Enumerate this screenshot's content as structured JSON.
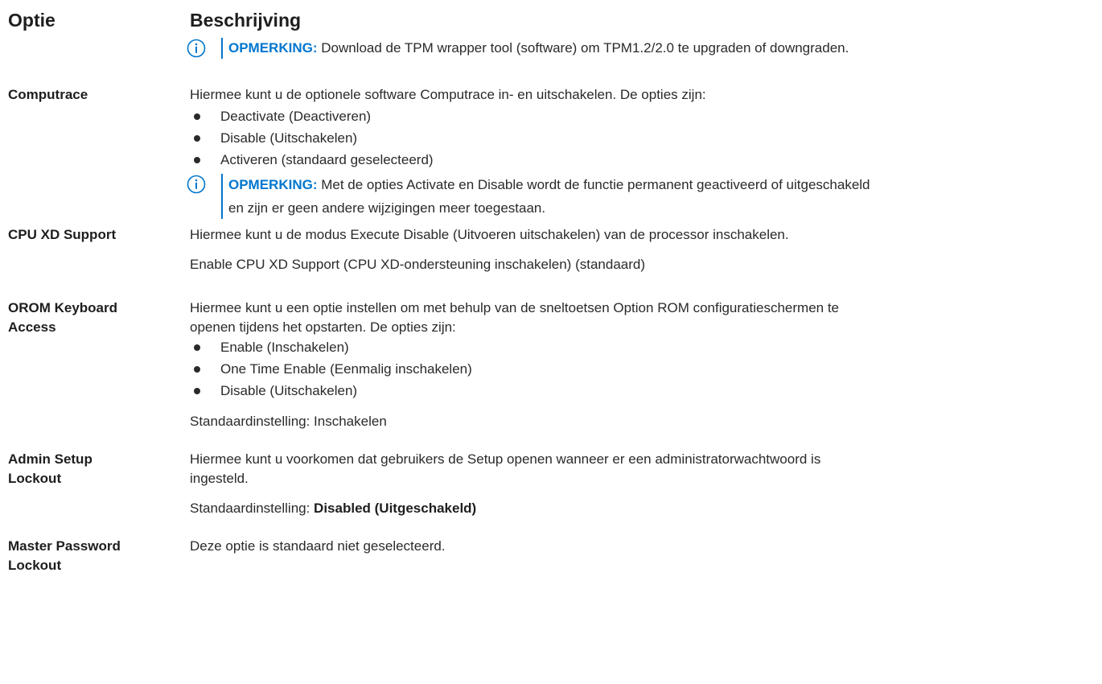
{
  "header": {
    "option": "Optie",
    "description": "Beschrijving"
  },
  "tpm_note": {
    "label": "OPMERKING:",
    "text": " Download de TPM wrapper tool (software) om TPM1.2/2.0 te upgraden of downgraden."
  },
  "computrace": {
    "label": "Computrace",
    "intro": "Hiermee kunt u de optionele software Computrace in- en uitschakelen. De opties zijn:",
    "items": [
      "Deactivate (Deactiveren)",
      "Disable (Uitschakelen)",
      "Activeren (standaard geselecteerd)"
    ],
    "note_label": "OPMERKING:",
    "note_line1": " Met de opties Activate en Disable wordt de functie permanent geactiveerd of uitgeschakeld",
    "note_line2": "en zijn er geen andere wijzigingen meer toegestaan."
  },
  "cpu_xd": {
    "label": "CPU XD Support",
    "line1": "Hiermee kunt u de modus Execute Disable (Uitvoeren uitschakelen) van de processor inschakelen.",
    "line2": "Enable CPU XD Support (CPU XD-ondersteuning inschakelen) (standaard)"
  },
  "orom": {
    "label_line1": "OROM Keyboard",
    "label_line2": "Access",
    "intro_line1": "Hiermee kunt u een optie instellen om met behulp van de sneltoetsen Option ROM configuratieschermen te",
    "intro_line2": "openen tijdens het opstarten. De opties zijn:",
    "items": [
      "Enable (Inschakelen)",
      "One Time Enable (Eenmalig inschakelen)",
      "Disable (Uitschakelen)"
    ],
    "default": "Standaardinstelling: Inschakelen"
  },
  "admin_lockout": {
    "label_line1": "Admin Setup",
    "label_line2": "Lockout",
    "line1": "Hiermee kunt u voorkomen dat gebruikers de Setup openen wanneer er een administratorwachtwoord is",
    "line2": "ingesteld.",
    "default_prefix": "Standaardinstelling: ",
    "default_value": "Disabled (Uitgeschakeld)"
  },
  "master_lockout": {
    "label_line1": "Master Password",
    "label_line2": "Lockout",
    "text": "Deze optie is standaard niet geselecteerd."
  },
  "colors": {
    "accent": "#0076ce",
    "text": "#2a2a2a"
  },
  "icons": {
    "note": "info-circle-icon",
    "bullet": "bullet-dot-icon"
  }
}
